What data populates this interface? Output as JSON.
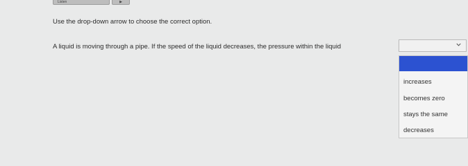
{
  "toolbar": {
    "listen_label": "Listen",
    "play_icon": "play-icon"
  },
  "instruction": "Use the drop-down arrow to choose the correct option.",
  "question": "A liquid is moving through a pipe. If the speed of the liquid decreases, the pressure within the liquid",
  "select": {
    "selected_value": "",
    "icon": "chevron-down-icon"
  },
  "dropdown": {
    "options": [
      "",
      "increases",
      "becomes zero",
      "stays the same",
      "decreases"
    ],
    "highlight_color": "#2c52d1"
  }
}
